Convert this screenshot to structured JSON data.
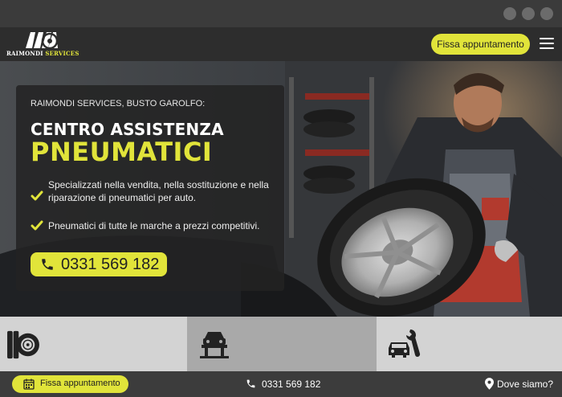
{
  "header": {
    "brand_name": "RAIMONDI",
    "brand_accent": "SERVICES",
    "cta_label": "Fissa appuntamento",
    "menu_icon": "hamburger-icon"
  },
  "hero": {
    "eyebrow": "RAIMONDI SERVICES, BUSTO GAROLFO:",
    "title_line1": "CENTRO ASSISTENZA",
    "title_line2": "PNEUMATICI",
    "bullets": [
      "Specializzati nella vendita, nella sostituzione e nella riparazione di pneumatici per auto.",
      "Pneumatici di tutte le marche a prezzi competitivi."
    ],
    "phone": "0331 569 182"
  },
  "services": [
    {
      "icon": "tire-icon",
      "bg": "#d3d3d3"
    },
    {
      "icon": "car-lift-icon",
      "bg": "#a9a9a9"
    },
    {
      "icon": "car-repair-icon",
      "bg": "#d3d3d3"
    }
  ],
  "bottom_bar": {
    "appointment_label": "Fissa appuntamento",
    "phone": "0331 569 182",
    "location_label": "Dove siamo?"
  },
  "colors": {
    "accent": "#e1e43a",
    "header_bg": "#2d2d2d",
    "bar_bg": "#3c3c3c"
  }
}
